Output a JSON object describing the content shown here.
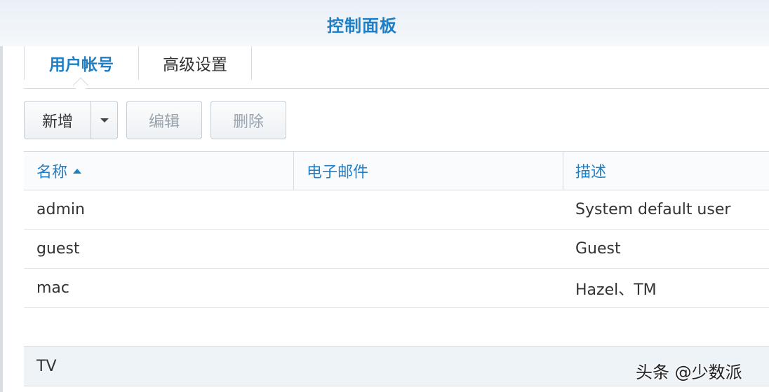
{
  "window": {
    "title": "控制面板"
  },
  "tabs": [
    {
      "label": "用户帐号",
      "active": true
    },
    {
      "label": "高级设置",
      "active": false
    }
  ],
  "toolbar": {
    "add_label": "新增",
    "edit_label": "编辑",
    "delete_label": "删除"
  },
  "table": {
    "columns": [
      "名称",
      "电子邮件",
      "描述"
    ],
    "sort": {
      "column": "名称",
      "direction": "ascending"
    },
    "rows": [
      {
        "name": "admin",
        "email": "",
        "description": "System default user"
      },
      {
        "name": "guest",
        "email": "",
        "description": "Guest"
      },
      {
        "name": "mac",
        "email": "",
        "description": "Hazel、TM"
      }
    ]
  },
  "group": {
    "label": "TV"
  },
  "watermark": "头条 @少数派",
  "colors": {
    "accent": "#1f7fc6",
    "disabled_text": "#9aa4ae",
    "border": "#d7dbe0"
  }
}
